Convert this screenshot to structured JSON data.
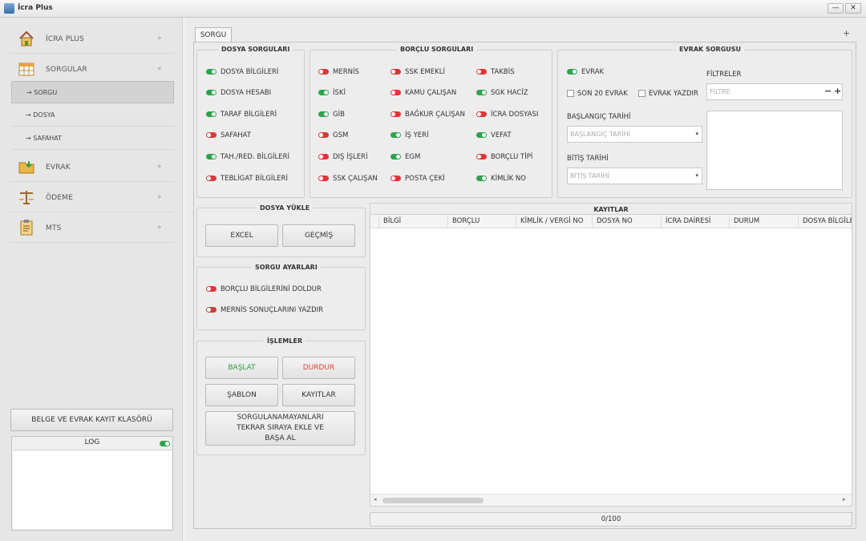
{
  "window": {
    "title": "İcra Plus",
    "minimize": "—",
    "close": "✕"
  },
  "sidebar": {
    "menu": [
      {
        "label": "İCRA PLUS",
        "icon": "home-icon",
        "chevron": "»"
      },
      {
        "label": "SORGULAR",
        "icon": "table-icon",
        "chevron": "«"
      },
      {
        "label": "EVRAK",
        "icon": "folder-icon",
        "chevron": "»"
      },
      {
        "label": "ÖDEME",
        "icon": "scales-icon",
        "chevron": "»"
      },
      {
        "label": "MTS",
        "icon": "clipboard-icon",
        "chevron": "»"
      }
    ],
    "sub": [
      {
        "label": "→ SORGU"
      },
      {
        "label": "→ DOSYA"
      },
      {
        "label": "→ SAFAHAT"
      }
    ],
    "archive_button": "BELGE VE EVRAK KAYIT KLASÖRÜ",
    "log_title": "LOG"
  },
  "tab": {
    "label": "SORGU",
    "add": "+"
  },
  "dosya": {
    "title": "DOSYA SORGULARI",
    "items": [
      {
        "label": "DOSYA BİLGİLERİ",
        "state": "on"
      },
      {
        "label": "DOSYA HESABI",
        "state": "on"
      },
      {
        "label": "TARAF BİLGİLERİ",
        "state": "on"
      },
      {
        "label": "SAFAHAT",
        "state": "off"
      },
      {
        "label": "TAH./RED. BİLGİLERİ",
        "state": "on"
      },
      {
        "label": "TEBLİGAT BİLGİLERİ",
        "state": "off"
      }
    ]
  },
  "borclu": {
    "title": "BORÇLU SORGULARI",
    "col1": [
      {
        "label": "MERNİS",
        "state": "off"
      },
      {
        "label": "İSKİ",
        "state": "on"
      },
      {
        "label": "GİB",
        "state": "on"
      },
      {
        "label": "GSM",
        "state": "off"
      },
      {
        "label": "DIŞ İŞLERİ",
        "state": "off"
      },
      {
        "label": "SSK ÇALIŞAN",
        "state": "off"
      }
    ],
    "col2": [
      {
        "label": "SSK EMEKLİ",
        "state": "off"
      },
      {
        "label": "KAMU ÇALIŞAN",
        "state": "off"
      },
      {
        "label": "BAĞKUR ÇALIŞAN",
        "state": "off"
      },
      {
        "label": "İŞ YERİ",
        "state": "on"
      },
      {
        "label": "EGM",
        "state": "on"
      },
      {
        "label": "POSTA ÇEKİ",
        "state": "off"
      }
    ],
    "col3": [
      {
        "label": "TAKBİS",
        "state": "off"
      },
      {
        "label": "SGK HACİZ",
        "state": "on"
      },
      {
        "label": "İCRA DOSYASI",
        "state": "off"
      },
      {
        "label": "VEFAT",
        "state": "on"
      },
      {
        "label": "BORÇLU TİPİ",
        "state": "off"
      },
      {
        "label": "KİMLİK NO",
        "state": "on"
      }
    ]
  },
  "evrak": {
    "title": "EVRAK SORGUSU",
    "evrak_toggle": "EVRAK",
    "son20": "SON 20 EVRAK",
    "yazdir": "EVRAK YAZDIR",
    "start_label": "BAŞLANGIÇ TARİHİ",
    "start_placeholder": "BAŞLANGIÇ TARİHİ",
    "end_label": "BİTİŞ TARİHİ",
    "end_placeholder": "BİTİŞ TARİHİ",
    "filters_label": "FİLTRELER",
    "filter_placeholder": "FİLTRE",
    "minus": "−",
    "plus": "+"
  },
  "upload": {
    "title": "DOSYA YÜKLE",
    "excel": "EXCEL",
    "history": "GEÇMİŞ"
  },
  "settings": {
    "title": "SORGU AYARLARI",
    "items": [
      {
        "label": "BORÇLU BİLGİLERİNİ DOLDUR",
        "state": "off"
      },
      {
        "label": "MERNİS SONUÇLARINI YAZDIR",
        "state": "off"
      }
    ]
  },
  "actions": {
    "title": "İŞLEMLER",
    "start": "BAŞLAT",
    "stop": "DURDUR",
    "template": "ŞABLON",
    "records": "KAYITLAR",
    "requeue": "SORGULANAMAYANLARI TEKRAR SIRAYA EKLE VE BAŞA AL",
    "start_color": "#2e9e48",
    "stop_color": "#d9453a"
  },
  "records": {
    "title": "KAYITLAR",
    "columns": [
      "BİLGİ",
      "BORÇLU",
      "KİMLİK / VERGİ NO",
      "DOSYA NO",
      "İCRA DAİRESİ",
      "DURUM",
      "DOSYA BİLGİLERİ"
    ],
    "progress": "0/100"
  }
}
